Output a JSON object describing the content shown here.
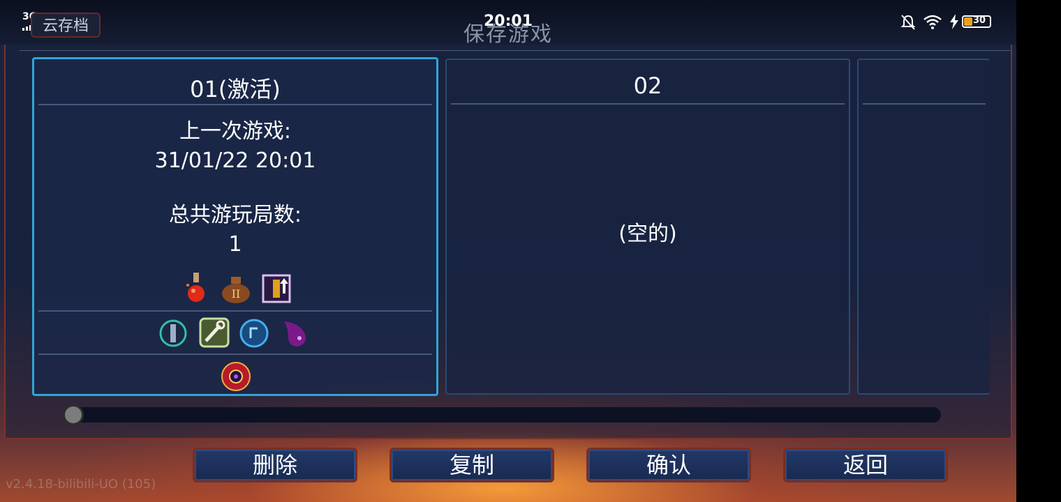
{
  "statusbar": {
    "network": "3G",
    "time": "20:01",
    "battery": "30"
  },
  "header": {
    "cloud_save_label": "云存档",
    "title": "保存游戏"
  },
  "slots": [
    {
      "title": "01(激活)",
      "last_game_label": "上一次游戏:",
      "last_game_time": "31/01/22 20:01",
      "total_runs_label": "总共游玩局数:",
      "total_runs": "1"
    },
    {
      "title": "02",
      "empty_label": "(空的)"
    },
    {
      "title": ""
    }
  ],
  "buttons": {
    "delete": "删除",
    "copy": "复制",
    "confirm": "确认",
    "back": "返回"
  },
  "footer": {
    "version": "v2.4.18-bilibili-UO (105)"
  },
  "colors": {
    "active_border": "#2fa6d8",
    "slot_border": "#2a4a72",
    "button_border": "#7a2e22"
  }
}
